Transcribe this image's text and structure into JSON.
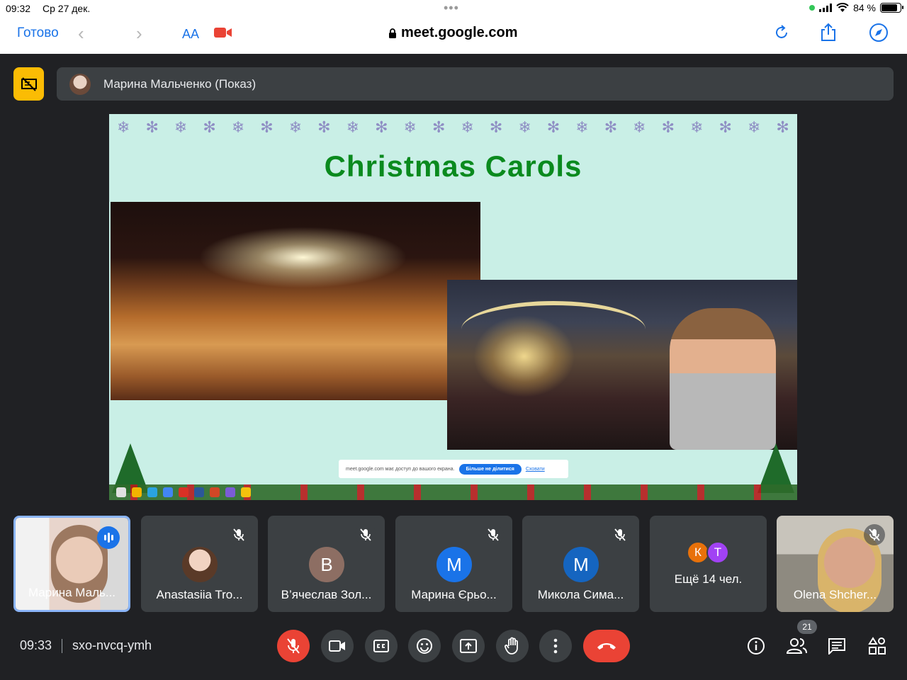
{
  "status_bar": {
    "time": "09:32",
    "date": "Ср 27 дек.",
    "battery": "84 %",
    "battery_level": 0.84
  },
  "safari": {
    "done_label": "Готово",
    "text_size_label": "AA",
    "url": "meet.google.com"
  },
  "presenter": {
    "name": "Марина Мальченко (Показ)"
  },
  "slide": {
    "title": "Christmas Carols",
    "share_notice": "meet.google.com має доступ до вашого екрана.",
    "stop_sharing_label": "Більше не ділитися",
    "hide_label": "Сховати"
  },
  "participants": [
    {
      "name": "Марина Маль...",
      "speaking": true
    },
    {
      "name": "Anastasiia Tro...",
      "muted": true
    },
    {
      "name": "В’ячеслав Зол...",
      "initial": "В",
      "color": "#8d6e63",
      "muted": true
    },
    {
      "name": "Марина Єрьо...",
      "initial": "М",
      "color": "#1a73e8",
      "muted": true
    },
    {
      "name": "Микола Сима...",
      "initial": "М",
      "color": "#1565c0",
      "muted": true
    },
    {
      "name": "Ещё 14 чел.",
      "initials": [
        "К",
        "Т"
      ],
      "colors": [
        "#e8710a",
        "#a142f4"
      ]
    },
    {
      "name": "Olena Shcher...",
      "muted": true
    }
  ],
  "meeting": {
    "time": "09:33",
    "code": "sxo-nvcq-ymh",
    "people_count": "21"
  },
  "colors": {
    "background": "#202124",
    "tile": "#3c4043",
    "end_call": "#ea4335",
    "present_button": "#fbbc04",
    "slide_title": "#0a8a1e"
  }
}
